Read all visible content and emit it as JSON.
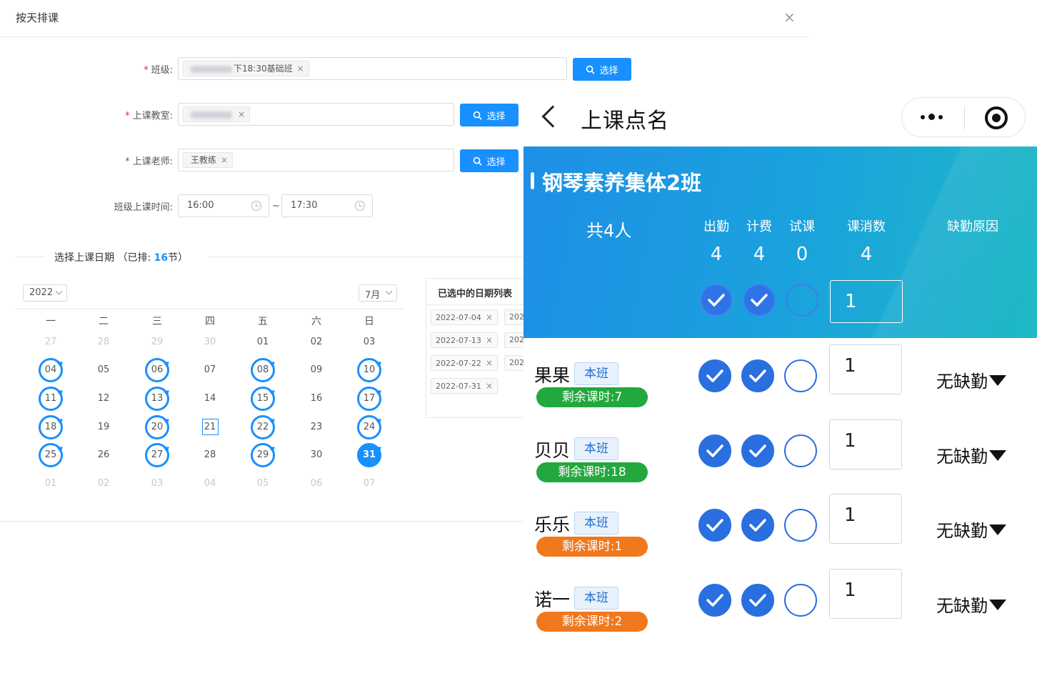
{
  "dialog": {
    "title": "按天排课",
    "close_icon": "×",
    "class_label": "班级:",
    "class_tag_suffix": "下18:30基础班",
    "classroom_label": "上课教室:",
    "teacher_label": "上课老师:",
    "teacher_tag": "王教练",
    "select_btn": "选择",
    "time_label": "班级上课时间:",
    "start_time": "16:00",
    "end_time": "17:30",
    "time_sep": "~",
    "section_prefix": "选择上课日期 （已排: ",
    "section_count": "16",
    "section_suffix": "节）",
    "year": "2022",
    "month": "7月"
  },
  "calendar": {
    "weekdays": [
      "一",
      "二",
      "三",
      "四",
      "五",
      "六",
      "日"
    ],
    "rows": [
      [
        "27",
        "28",
        "29",
        "30",
        "01",
        "02",
        "03"
      ],
      [
        "04",
        "05",
        "06",
        "07",
        "08",
        "09",
        "10"
      ],
      [
        "11",
        "12",
        "13",
        "14",
        "15",
        "16",
        "17"
      ],
      [
        "18",
        "19",
        "20",
        "21",
        "22",
        "23",
        "24"
      ],
      [
        "25",
        "26",
        "27",
        "28",
        "29",
        "30",
        "31"
      ],
      [
        "01",
        "02",
        "03",
        "04",
        "05",
        "06",
        "07"
      ]
    ]
  },
  "selected_panel": {
    "title": "已选中的日期列表",
    "dates": [
      "2022-07-04",
      "2022-07-13",
      "2022-07-22",
      "2022-07-31"
    ],
    "dates_col2": [
      "202",
      "202",
      "202"
    ]
  },
  "mobile": {
    "title": "上课点名",
    "class_name": "钢琴素养集体2班",
    "total": "共4人",
    "headers": [
      "出勤",
      "计费",
      "试课",
      "课消数",
      "缺勤原因"
    ],
    "summary_numbers": [
      "4",
      "4",
      "0",
      "4"
    ],
    "batch_value": "1",
    "badge_label": "本班",
    "students": [
      {
        "name": "果果",
        "remaining": "剩余课时:7",
        "count": "1",
        "reason": "无缺勤",
        "color": "#23a83e"
      },
      {
        "name": "贝贝",
        "remaining": "剩余课时:18",
        "count": "1",
        "reason": "无缺勤",
        "color": "#23a83e"
      },
      {
        "name": "乐乐",
        "remaining": "剩余课时:1",
        "count": "1",
        "reason": "无缺勤",
        "color": "#f0781d"
      },
      {
        "name": "诺一",
        "remaining": "剩余课时:2",
        "count": "1",
        "reason": "无缺勤",
        "color": "#f0781d"
      }
    ]
  },
  "colors": {
    "primary": "#1890ff",
    "check_blue": "#2a6fe0",
    "green": "#23a83e",
    "orange": "#f0781d"
  }
}
